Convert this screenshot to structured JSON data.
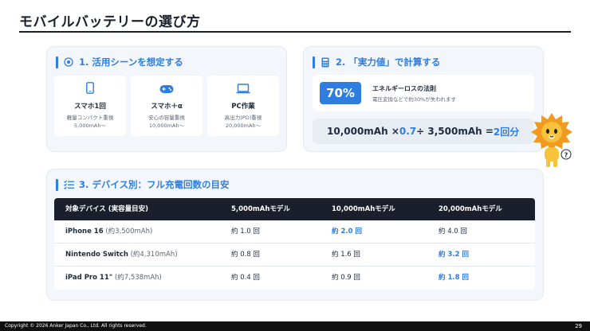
{
  "page": {
    "title": "モバイルバッテリーの選び方",
    "page_number": "29"
  },
  "footer": {
    "copyright": "Copyright © 2026 Anker Japan Co., Ltd. All rights reserved."
  },
  "section1": {
    "heading": "1. 活用シーンを想定する",
    "scenes": [
      {
        "icon": "smartphone-icon",
        "title": "スマホ1回",
        "line1": "軽量コンパクト重視",
        "line2": "5,000mAh〜"
      },
      {
        "icon": "gamepad-icon",
        "title": "スマホ＋α",
        "line1": "安心の容量重視",
        "line2": "10,000mAh〜"
      },
      {
        "icon": "laptop-icon",
        "title": "PC作業",
        "line1": "高出力(PD)重視",
        "line2": "20,000mAh〜"
      }
    ]
  },
  "section2": {
    "heading": "2. 「実力値」で計算する",
    "loss_badge": "70%",
    "loss_title": "エネルギーロスの法則",
    "loss_desc": "電圧変換などで約30%が失われます",
    "formula": {
      "part1": "10,000mAh × ",
      "factor": "0.7",
      "part2": " ÷ 3,500mAh = ",
      "result": "2回分"
    }
  },
  "section3": {
    "heading": "3. デバイス別：フル充電回数の目安",
    "columns": [
      "対象デバイス (実容量目安)",
      "5,000mAhモデル",
      "10,000mAhモデル",
      "20,000mAhモデル"
    ],
    "rows": [
      {
        "device": "iPhone 16",
        "note": " (約3,500mAh)",
        "values": [
          "約 1.0 回",
          "約 2.0 回",
          "約 4.0 回"
        ],
        "highlight": [
          false,
          true,
          false
        ]
      },
      {
        "device": "Nintendo Switch",
        "note": " (約4,310mAh)",
        "values": [
          "約 0.8 回",
          "約 1.6 回",
          "約 3.2 回"
        ],
        "highlight": [
          false,
          false,
          true
        ]
      },
      {
        "device": "iPad Pro 11\"",
        "note": " (約7,538mAh)",
        "values": [
          "約 0.4 回",
          "約 0.9 回",
          "約 1.8 回"
        ],
        "highlight": [
          false,
          false,
          true
        ]
      }
    ]
  },
  "colors": {
    "accent": "#2f7de1",
    "dark": "#1a1f2b",
    "card_bg": "#f3f6fa"
  }
}
